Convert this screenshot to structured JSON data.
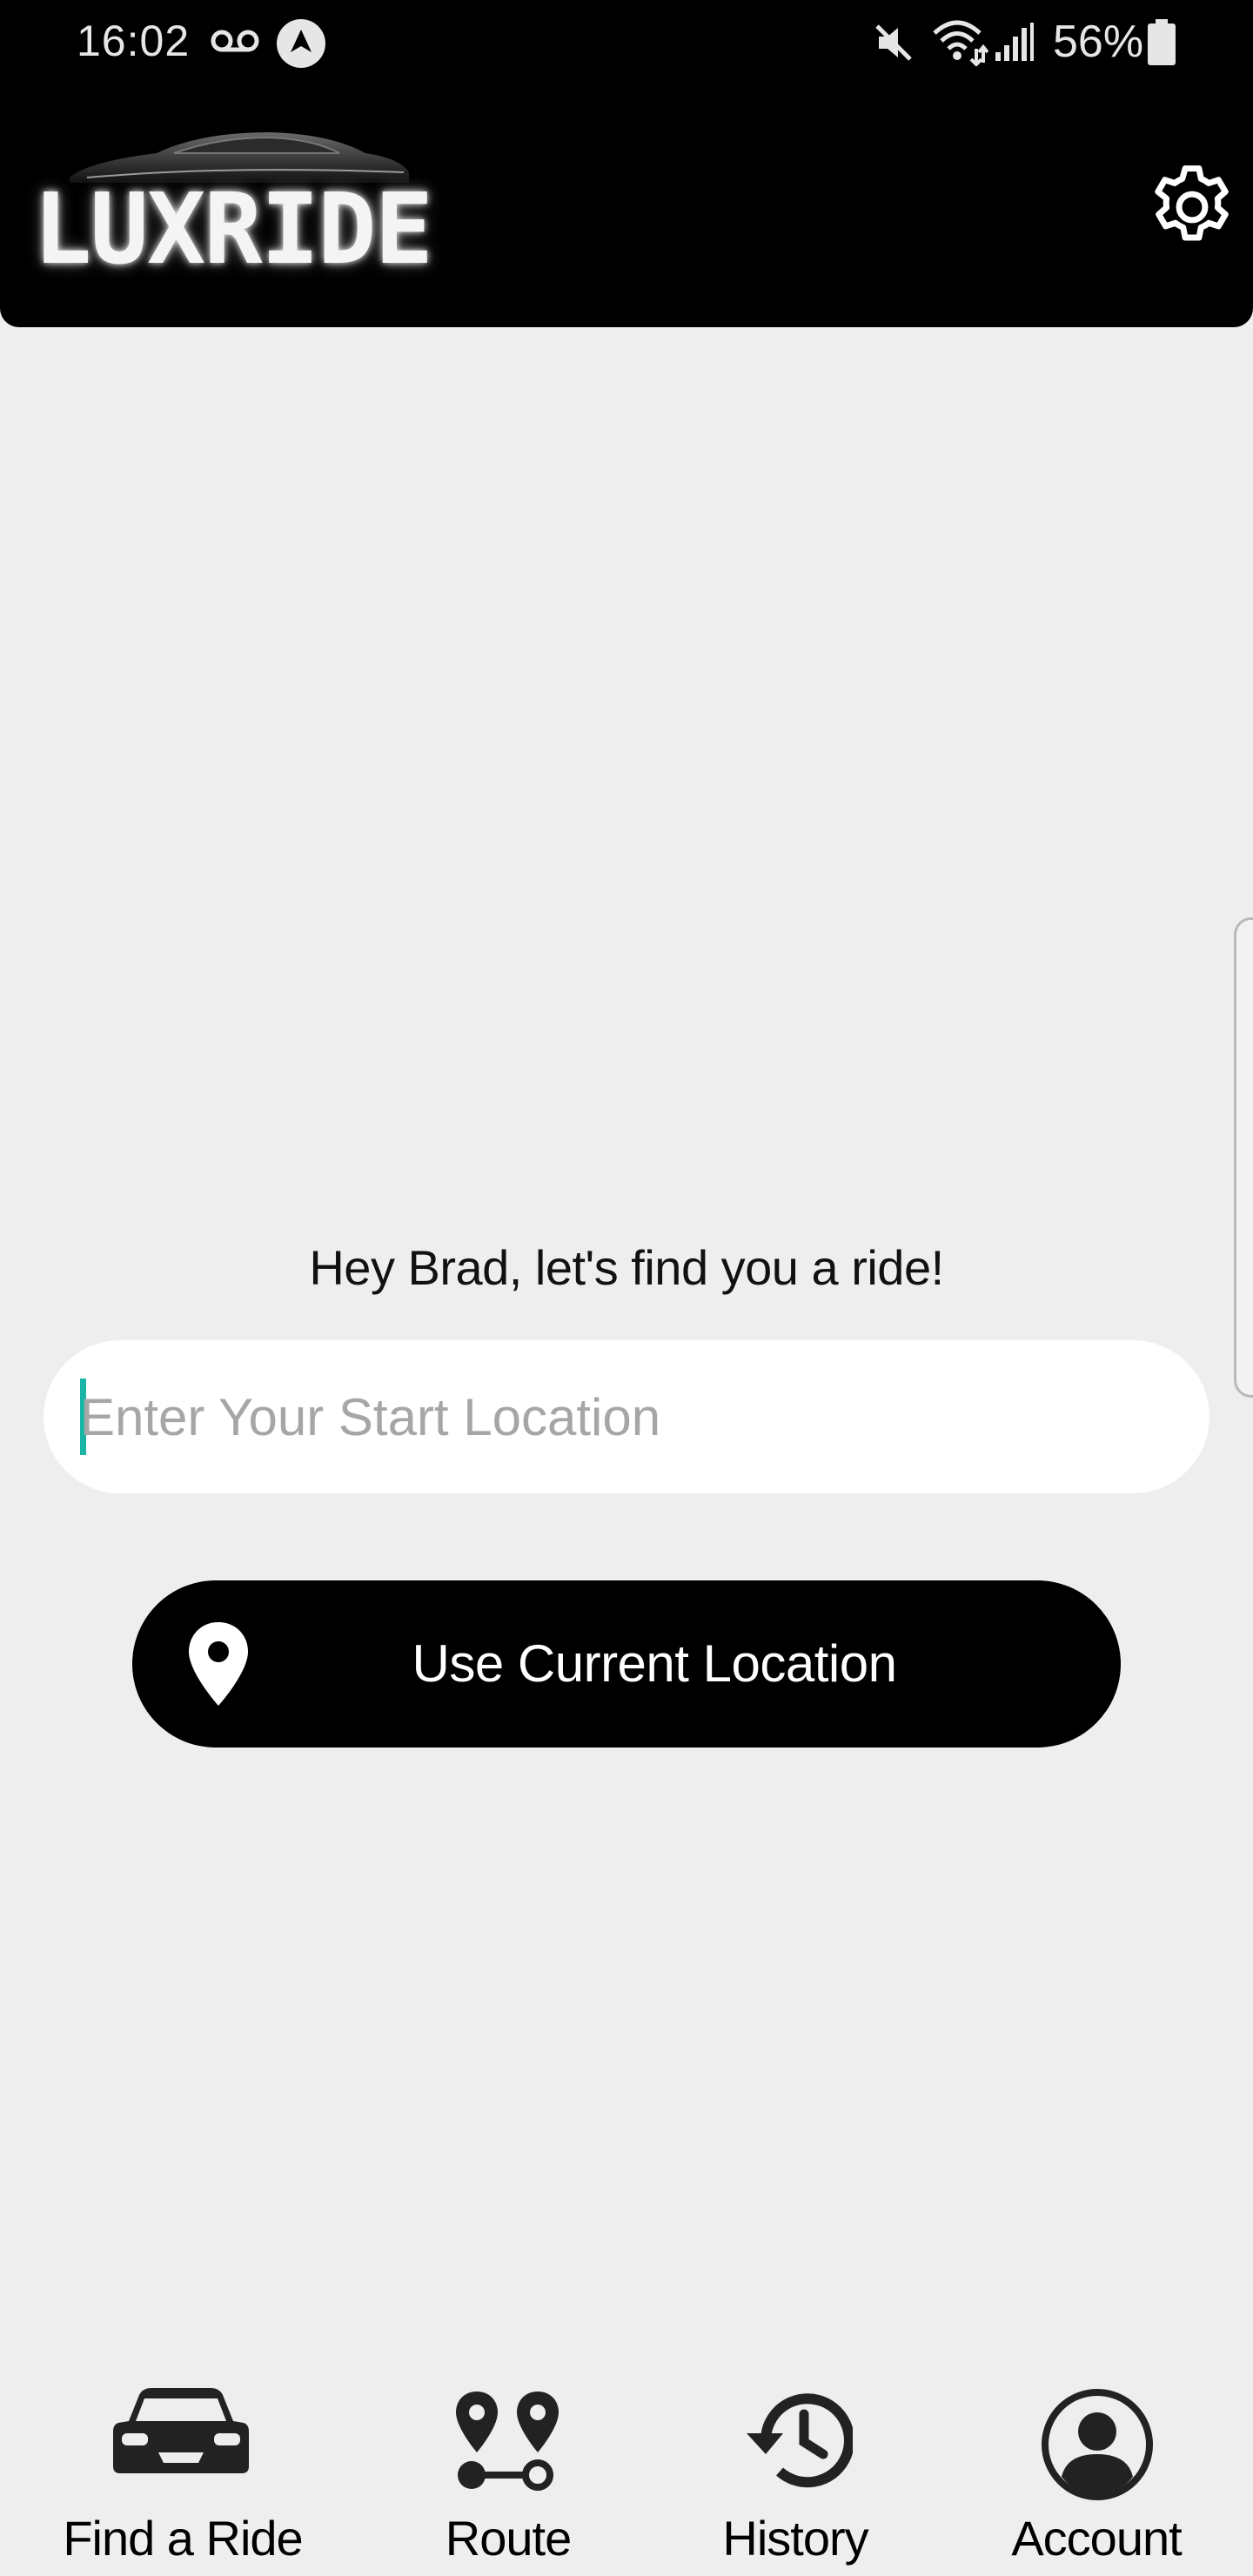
{
  "status_bar": {
    "time": "16:02",
    "battery": "56%",
    "icons": [
      "voicemail-icon",
      "navigation-icon",
      "mute-icon",
      "wifi-icon",
      "signal-icon",
      "battery-icon"
    ]
  },
  "header": {
    "logo_text": "LUXRIDE",
    "settings_icon": "gear-icon"
  },
  "main": {
    "greeting": "Hey Brad, let's find you a ride!",
    "start_location": {
      "value": "",
      "placeholder": "Enter Your Start Location"
    },
    "current_location_button": {
      "label": "Use Current Location",
      "icon": "map-pin-icon"
    }
  },
  "bottom_nav": {
    "items": [
      {
        "label": "Find a Ride",
        "icon": "car-icon"
      },
      {
        "label": "Route",
        "icon": "route-icon"
      },
      {
        "label": "History",
        "icon": "history-icon"
      },
      {
        "label": "Account",
        "icon": "account-icon"
      }
    ]
  },
  "colors": {
    "header_bg": "#000000",
    "page_bg": "#eeeeee",
    "accent_caret": "#1ab5a6",
    "button_bg": "#000000"
  }
}
